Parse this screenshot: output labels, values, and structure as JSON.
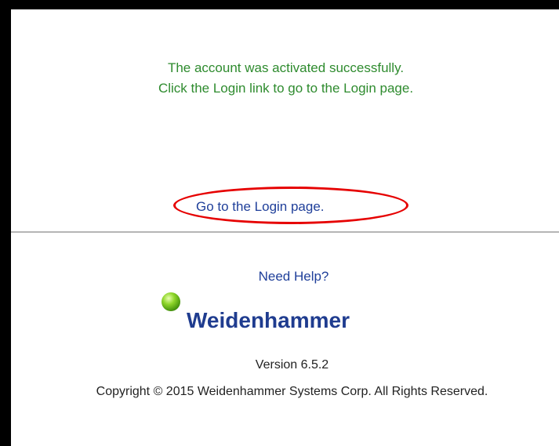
{
  "message": {
    "line1": "The account was activated successfully.",
    "line2": "Click the Login link to go to the Login page."
  },
  "login_link": {
    "label": "Go to the Login page."
  },
  "footer": {
    "help_label": "Need Help?",
    "logo_text": "Weidenhammer",
    "version": "Version 6.5.2",
    "copyright": "Copyright © 2015 Weidenhammer Systems Corp. All Rights Reserved."
  },
  "colors": {
    "message": "#2e8b2e",
    "link": "#1f3f9a",
    "highlight": "#e60000",
    "logo_text": "#1f3c8f",
    "logo_dot": "#7cc520"
  }
}
